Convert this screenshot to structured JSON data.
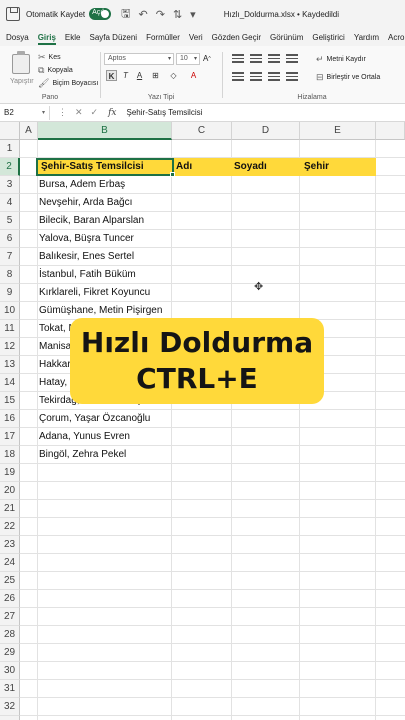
{
  "titlebar": {
    "autosave_label": "Otomatik Kaydet",
    "toggle_state": "Açık",
    "filename": "Hızlı_Doldurma.xlsx • Kaydedildi",
    "icons": [
      "save-icon",
      "undo-icon",
      "redo-icon",
      "sort-icon",
      "more-icon"
    ]
  },
  "menu": {
    "tabs": [
      "Dosya",
      "Giriş",
      "Ekle",
      "Sayfa Düzeni",
      "Formüller",
      "Veri",
      "Gözden Geçir",
      "Görünüm",
      "Geliştirici",
      "Yardım",
      "Acrobat"
    ],
    "active_index": 1
  },
  "ribbon": {
    "paste_label": "Yapıştır",
    "cut": "Kes",
    "copy": "Kopyala",
    "format_painter": "Biçim Boyacısı",
    "group_clipboard": "Pano",
    "font_name": "Aptos",
    "font_size": "10",
    "group_font": "Yazı Tipi",
    "wrap_text": "Metni Kaydır",
    "merge_center": "Birleştir ve Ortala",
    "group_align": "Hizalama",
    "bold": "K",
    "italic": "T",
    "underline": "A"
  },
  "formula": {
    "name_box": "B2",
    "fx": "fx",
    "content": "Şehir-Satış Temsilcisi"
  },
  "grid": {
    "columns": [
      "A",
      "B",
      "C",
      "D",
      "E"
    ],
    "rows": [
      "1",
      "2",
      "3",
      "4",
      "5",
      "6",
      "7",
      "8",
      "9",
      "10",
      "11",
      "12",
      "13",
      "14",
      "15",
      "16",
      "17",
      "18",
      "19",
      "20",
      "21",
      "22",
      "23",
      "24",
      "25",
      "26",
      "27",
      "28",
      "29",
      "30",
      "31",
      "32",
      "33"
    ],
    "selected_cell": "B2"
  },
  "sheet": {
    "headers": {
      "b": "Şehir-Satış Temsilcisi",
      "c": "Adı",
      "d": "Soyadı",
      "e": "Şehir"
    },
    "values": [
      "Bursa, Adem Erbaş",
      "Nevşehir, Arda Bağcı",
      "Bilecik, Baran Alparslan",
      "Yalova, Büşra Tuncer",
      "Balıkesir, Enes Sertel",
      "İstanbul, Fatih Büküm",
      "Kırklareli, Fikret Koyuncu",
      "Gümüşhane, Metin Pişirgen",
      "Tokat, Ne",
      "Manisa, N",
      "Hakkari, Seda Kuş",
      "Hatay, Umut Kartal",
      "Tekirdağ, Yaren Yamaç",
      "Çorum, Yaşar Özcanoğlu",
      "Adana, Yunus Evren",
      "Bingöl, Zehra Pekel"
    ]
  },
  "overlay": {
    "line1": "Hızlı Doldurma",
    "line2": "CTRL+E"
  },
  "colors": {
    "accent": "#1e7145",
    "highlight": "#ffd93a"
  }
}
